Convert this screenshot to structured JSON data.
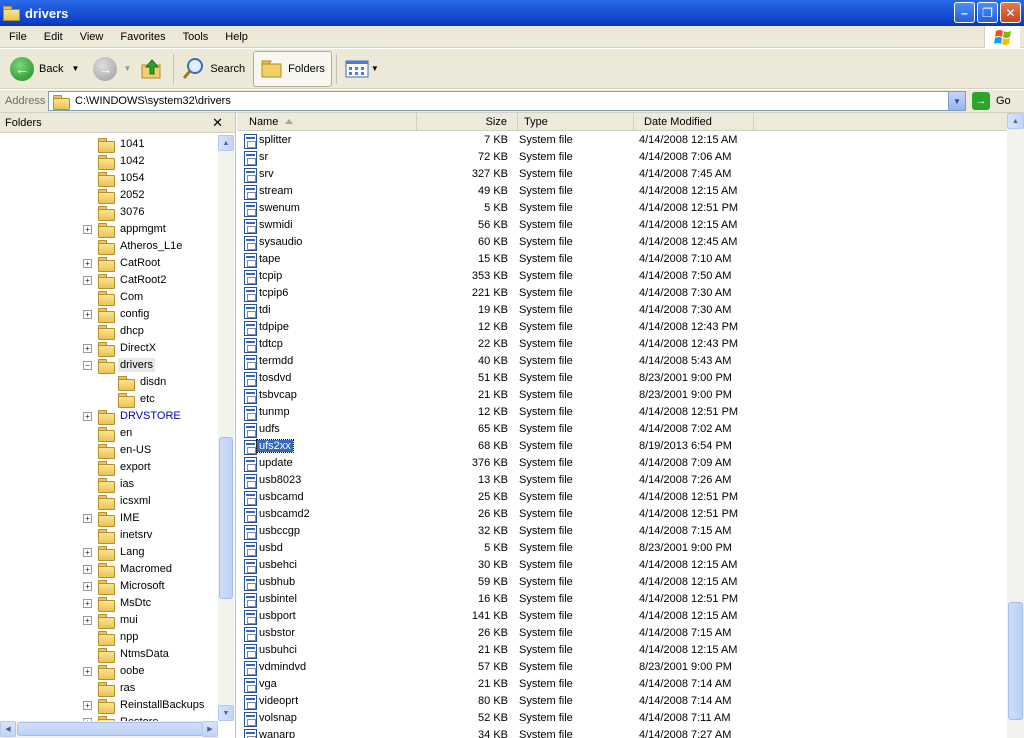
{
  "window": {
    "title": "drivers"
  },
  "menu": [
    "File",
    "Edit",
    "View",
    "Favorites",
    "Tools",
    "Help"
  ],
  "toolbar": {
    "back": "Back",
    "search": "Search",
    "folders": "Folders"
  },
  "address": {
    "label": "Address",
    "path": "C:\\WINDOWS\\system32\\drivers",
    "go": "Go"
  },
  "folderpane": {
    "title": "Folders",
    "items": [
      {
        "label": "1041",
        "level": 1,
        "exp": ""
      },
      {
        "label": "1042",
        "level": 1,
        "exp": ""
      },
      {
        "label": "1054",
        "level": 1,
        "exp": ""
      },
      {
        "label": "2052",
        "level": 1,
        "exp": ""
      },
      {
        "label": "3076",
        "level": 1,
        "exp": ""
      },
      {
        "label": "appmgmt",
        "level": 1,
        "exp": "+"
      },
      {
        "label": "Atheros_L1e",
        "level": 1,
        "exp": ""
      },
      {
        "label": "CatRoot",
        "level": 1,
        "exp": "+"
      },
      {
        "label": "CatRoot2",
        "level": 1,
        "exp": "+"
      },
      {
        "label": "Com",
        "level": 1,
        "exp": ""
      },
      {
        "label": "config",
        "level": 1,
        "exp": "+"
      },
      {
        "label": "dhcp",
        "level": 1,
        "exp": ""
      },
      {
        "label": "DirectX",
        "level": 1,
        "exp": "+"
      },
      {
        "label": "drivers",
        "level": 1,
        "exp": "-",
        "selected": true
      },
      {
        "label": "disdn",
        "level": 2,
        "exp": ""
      },
      {
        "label": "etc",
        "level": 2,
        "exp": ""
      },
      {
        "label": "DRVSTORE",
        "level": 1,
        "exp": "+",
        "blue": true
      },
      {
        "label": "en",
        "level": 1,
        "exp": ""
      },
      {
        "label": "en-US",
        "level": 1,
        "exp": ""
      },
      {
        "label": "export",
        "level": 1,
        "exp": ""
      },
      {
        "label": "ias",
        "level": 1,
        "exp": ""
      },
      {
        "label": "icsxml",
        "level": 1,
        "exp": ""
      },
      {
        "label": "IME",
        "level": 1,
        "exp": "+"
      },
      {
        "label": "inetsrv",
        "level": 1,
        "exp": ""
      },
      {
        "label": "Lang",
        "level": 1,
        "exp": "+"
      },
      {
        "label": "Macromed",
        "level": 1,
        "exp": "+"
      },
      {
        "label": "Microsoft",
        "level": 1,
        "exp": "+"
      },
      {
        "label": "MsDtc",
        "level": 1,
        "exp": "+"
      },
      {
        "label": "mui",
        "level": 1,
        "exp": "+"
      },
      {
        "label": "npp",
        "level": 1,
        "exp": ""
      },
      {
        "label": "NtmsData",
        "level": 1,
        "exp": ""
      },
      {
        "label": "oobe",
        "level": 1,
        "exp": "+"
      },
      {
        "label": "ras",
        "level": 1,
        "exp": ""
      },
      {
        "label": "ReinstallBackups",
        "level": 1,
        "exp": "+"
      },
      {
        "label": "Restore",
        "level": 1,
        "exp": "+"
      }
    ]
  },
  "columns": {
    "name": "Name",
    "size": "Size",
    "type": "Type",
    "date": "Date Modified"
  },
  "files": [
    {
      "name": "splitter",
      "size": "7 KB",
      "type": "System file",
      "date": "4/14/2008 12:15 AM"
    },
    {
      "name": "sr",
      "size": "72 KB",
      "type": "System file",
      "date": "4/14/2008 7:06 AM"
    },
    {
      "name": "srv",
      "size": "327 KB",
      "type": "System file",
      "date": "4/14/2008 7:45 AM"
    },
    {
      "name": "stream",
      "size": "49 KB",
      "type": "System file",
      "date": "4/14/2008 12:15 AM"
    },
    {
      "name": "swenum",
      "size": "5 KB",
      "type": "System file",
      "date": "4/14/2008 12:51 PM"
    },
    {
      "name": "swmidi",
      "size": "56 KB",
      "type": "System file",
      "date": "4/14/2008 12:15 AM"
    },
    {
      "name": "sysaudio",
      "size": "60 KB",
      "type": "System file",
      "date": "4/14/2008 12:45 AM"
    },
    {
      "name": "tape",
      "size": "15 KB",
      "type": "System file",
      "date": "4/14/2008 7:10 AM"
    },
    {
      "name": "tcpip",
      "size": "353 KB",
      "type": "System file",
      "date": "4/14/2008 7:50 AM"
    },
    {
      "name": "tcpip6",
      "size": "221 KB",
      "type": "System file",
      "date": "4/14/2008 7:30 AM"
    },
    {
      "name": "tdi",
      "size": "19 KB",
      "type": "System file",
      "date": "4/14/2008 7:30 AM"
    },
    {
      "name": "tdpipe",
      "size": "12 KB",
      "type": "System file",
      "date": "4/14/2008 12:43 PM"
    },
    {
      "name": "tdtcp",
      "size": "22 KB",
      "type": "System file",
      "date": "4/14/2008 12:43 PM"
    },
    {
      "name": "termdd",
      "size": "40 KB",
      "type": "System file",
      "date": "4/14/2008 5:43 AM"
    },
    {
      "name": "tosdvd",
      "size": "51 KB",
      "type": "System file",
      "date": "8/23/2001 9:00 PM"
    },
    {
      "name": "tsbvcap",
      "size": "21 KB",
      "type": "System file",
      "date": "8/23/2001 9:00 PM"
    },
    {
      "name": "tunmp",
      "size": "12 KB",
      "type": "System file",
      "date": "4/14/2008 12:51 PM"
    },
    {
      "name": "udfs",
      "size": "65 KB",
      "type": "System file",
      "date": "4/14/2008 7:02 AM"
    },
    {
      "name": "ufs2xx",
      "size": "68 KB",
      "type": "System file",
      "date": "8/19/2013 6:54 PM",
      "selected": true
    },
    {
      "name": "update",
      "size": "376 KB",
      "type": "System file",
      "date": "4/14/2008 7:09 AM"
    },
    {
      "name": "usb8023",
      "size": "13 KB",
      "type": "System file",
      "date": "4/14/2008 7:26 AM"
    },
    {
      "name": "usbcamd",
      "size": "25 KB",
      "type": "System file",
      "date": "4/14/2008 12:51 PM"
    },
    {
      "name": "usbcamd2",
      "size": "26 KB",
      "type": "System file",
      "date": "4/14/2008 12:51 PM"
    },
    {
      "name": "usbccgp",
      "size": "32 KB",
      "type": "System file",
      "date": "4/14/2008 7:15 AM"
    },
    {
      "name": "usbd",
      "size": "5 KB",
      "type": "System file",
      "date": "8/23/2001 9:00 PM"
    },
    {
      "name": "usbehci",
      "size": "30 KB",
      "type": "System file",
      "date": "4/14/2008 12:15 AM"
    },
    {
      "name": "usbhub",
      "size": "59 KB",
      "type": "System file",
      "date": "4/14/2008 12:15 AM"
    },
    {
      "name": "usbintel",
      "size": "16 KB",
      "type": "System file",
      "date": "4/14/2008 12:51 PM"
    },
    {
      "name": "usbport",
      "size": "141 KB",
      "type": "System file",
      "date": "4/14/2008 12:15 AM"
    },
    {
      "name": "usbstor",
      "size": "26 KB",
      "type": "System file",
      "date": "4/14/2008 7:15 AM"
    },
    {
      "name": "usbuhci",
      "size": "21 KB",
      "type": "System file",
      "date": "4/14/2008 12:15 AM"
    },
    {
      "name": "vdmindvd",
      "size": "57 KB",
      "type": "System file",
      "date": "8/23/2001 9:00 PM"
    },
    {
      "name": "vga",
      "size": "21 KB",
      "type": "System file",
      "date": "4/14/2008 7:14 AM"
    },
    {
      "name": "videoprt",
      "size": "80 KB",
      "type": "System file",
      "date": "4/14/2008 7:14 AM"
    },
    {
      "name": "volsnap",
      "size": "52 KB",
      "type": "System file",
      "date": "4/14/2008 7:11 AM"
    },
    {
      "name": "wanarp",
      "size": "34 KB",
      "type": "System file",
      "date": "4/14/2008 7:27 AM"
    }
  ],
  "colors": {
    "titlebar": "#0d40c7",
    "selection": "#316ac5",
    "chrome": "#ece9d8"
  }
}
